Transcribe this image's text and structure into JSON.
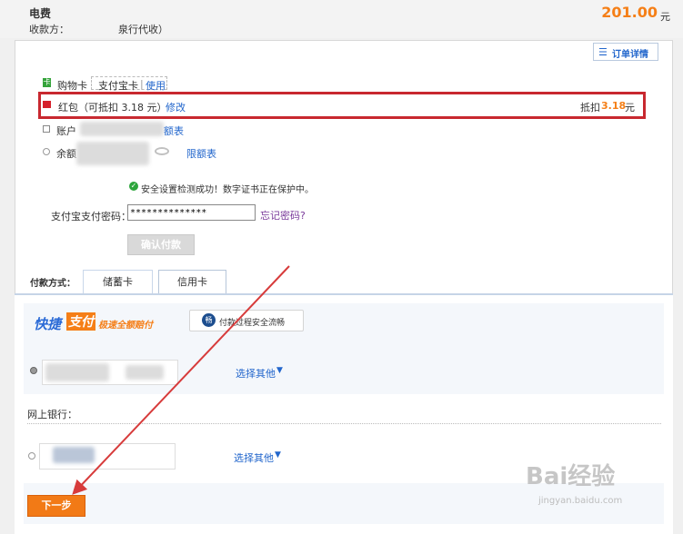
{
  "header": {
    "title": "电费",
    "payee_label": "收款方：",
    "payee_value": "泉行代收）",
    "amount": "201.00",
    "amount_unit": "元"
  },
  "order_detail_label": "订单详情",
  "payment_options": {
    "shopping_card": "购物卡",
    "alipay_card": "支付宝卡",
    "use_link": "使用",
    "red_envelope": "红包（可抵扣 3.18 元）",
    "modify_link": "修改",
    "deduction_label": "抵扣",
    "deduction_value": "3.18",
    "deduction_unit": "元",
    "account_label": "账户",
    "account_link": "额表",
    "balance_label": "余额",
    "limit_link": "限额表"
  },
  "security": {
    "message": "安全设置检测成功！数字证书正在保护中。",
    "password_label": "支付宝支付密码：",
    "password_value": "**************",
    "forgot_link": "忘记密码?",
    "confirm_button": "确认付款"
  },
  "payment_method": {
    "label": "付款方式：",
    "tabs": [
      "储蓄卡",
      "信用卡"
    ],
    "quickpay_logo": {
      "a": "快捷",
      "b": "支付",
      "c": "极速全额赔付"
    },
    "safe_badge": "付款过程安全流畅",
    "choose_other_1": "选择其他",
    "online_bank_label": "网上银行：",
    "choose_other_2": "选择其他",
    "next_button": "下一步"
  },
  "watermark": {
    "text": "Bai经验",
    "url": "jingyan.baidu.com"
  },
  "colors": {
    "orange": "#f57f17",
    "red_box": "#c8282f",
    "link": "#2266cc",
    "next_button": "#f27a16"
  }
}
